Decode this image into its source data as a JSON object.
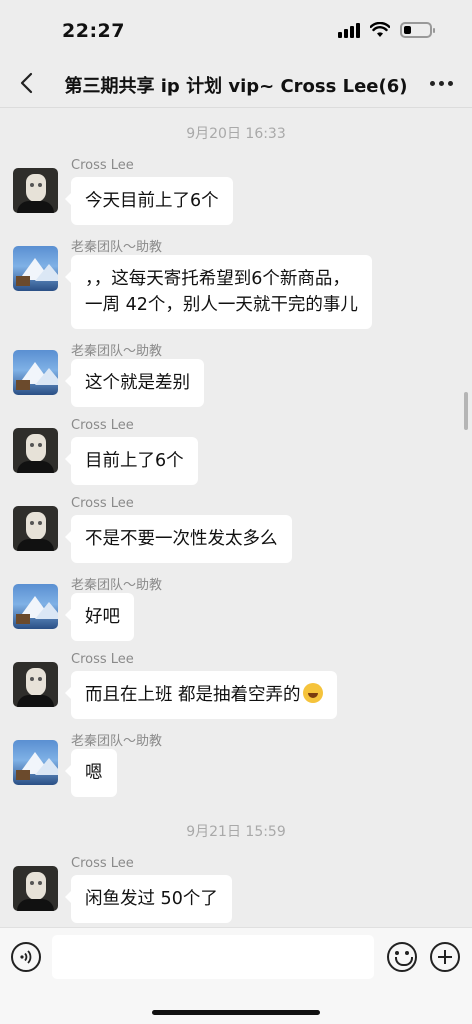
{
  "status_bar": {
    "time": "22:27",
    "battery_level": 0.25,
    "icons": [
      "signal-icon",
      "wifi-icon",
      "battery-icon"
    ]
  },
  "nav": {
    "title": "第三期共享 ip 计划 vip~ Cross Lee(6)",
    "back_icon": "chevron-left-icon",
    "more_icon": "more-dots-icon"
  },
  "chat": {
    "timestamps": [
      "9月20日 16:33",
      "9月21日 15:59"
    ],
    "messages": [
      {
        "sender": "Cross Lee",
        "avatar": "masked-person-avatar",
        "text": "今天目前上了6个"
      },
      {
        "sender": "老秦团队～助教",
        "avatar": "mountain-avatar",
        "line1": "，，这每天寄托希望到6个新商品，",
        "line2": "一周 42个，别人一天就干完的事儿"
      },
      {
        "sender": "老秦团队～助教",
        "avatar": "mountain-avatar",
        "text": "这个就是差别"
      },
      {
        "sender": "Cross Lee",
        "avatar": "masked-person-avatar",
        "text": "目前上了6个"
      },
      {
        "sender": "Cross Lee",
        "avatar": "masked-person-avatar",
        "text": "不是不要一次性发太多么"
      },
      {
        "sender": "老秦团队～助教",
        "avatar": "mountain-avatar",
        "text": "好吧"
      },
      {
        "sender": "Cross Lee",
        "avatar": "masked-person-avatar",
        "text": "而且在上班 都是抽着空弄的",
        "emoji": "tears-of-joy-emoji"
      },
      {
        "sender": "老秦团队～助教",
        "avatar": "mountain-avatar",
        "text": "嗯"
      },
      {
        "sender": "Cross Lee",
        "avatar": "masked-person-avatar",
        "text": "闲鱼发过 50个了"
      }
    ]
  },
  "input_bar": {
    "placeholder": "",
    "icons": [
      "voice-icon",
      "emoji-face-icon",
      "plus-icon"
    ]
  }
}
